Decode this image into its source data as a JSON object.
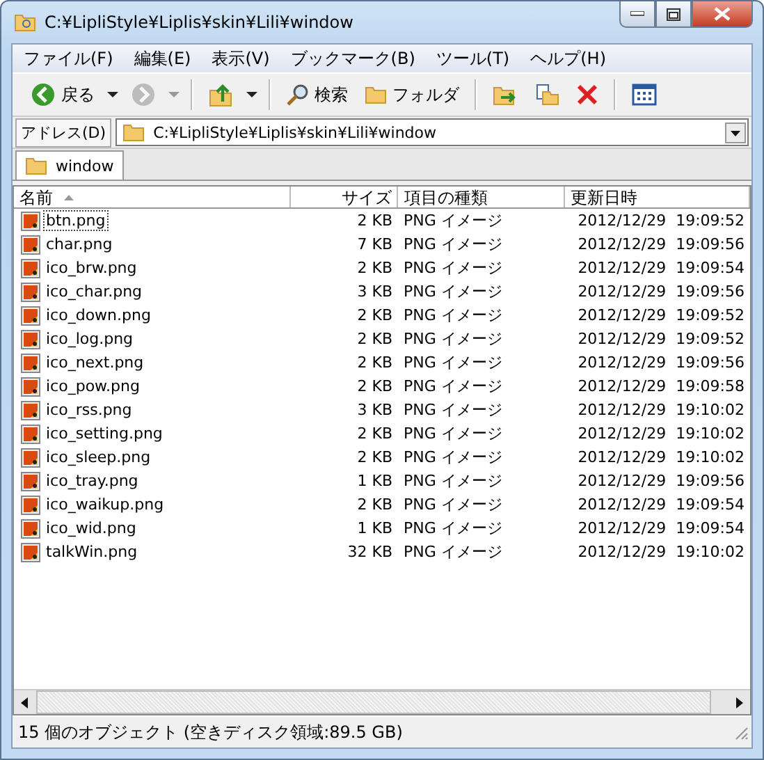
{
  "window": {
    "title": "C:¥LipliStyle¥Liplis¥skin¥Lili¥window"
  },
  "menu": [
    "ファイル(F)",
    "編集(E)",
    "表示(V)",
    "ブックマーク(B)",
    "ツール(T)",
    "ヘルプ(H)"
  ],
  "toolbar": [
    {
      "kind": "back",
      "label": "戻る",
      "disabled": false
    },
    {
      "kind": "caret",
      "disabled": false
    },
    {
      "kind": "forward",
      "disabled": true
    },
    {
      "kind": "caret",
      "disabled": true
    },
    {
      "kind": "sep"
    },
    {
      "kind": "up",
      "disabled": false
    },
    {
      "kind": "caret",
      "disabled": false
    },
    {
      "kind": "sep"
    },
    {
      "kind": "search",
      "label": "検索",
      "disabled": false
    },
    {
      "kind": "folders",
      "label": "フォルダ",
      "disabled": false
    },
    {
      "kind": "sep"
    },
    {
      "kind": "moveto",
      "disabled": false
    },
    {
      "kind": "copyto",
      "disabled": false
    },
    {
      "kind": "delete",
      "disabled": false
    },
    {
      "kind": "sep"
    },
    {
      "kind": "views",
      "disabled": false
    }
  ],
  "address": {
    "label": "アドレス(D)",
    "value": "C:¥LipliStyle¥Liplis¥skin¥Lili¥window"
  },
  "tabs": [
    {
      "label": "window",
      "selected": true
    }
  ],
  "table": {
    "columns": [
      "名前",
      "サイズ",
      "項目の種類",
      "更新日時"
    ],
    "rows": [
      {
        "name": "btn.png",
        "size": "2 KB",
        "type": "PNG イメージ",
        "modified": "2012/12/29  19:09:52",
        "focused": true
      },
      {
        "name": "char.png",
        "size": "7 KB",
        "type": "PNG イメージ",
        "modified": "2012/12/29  19:09:56",
        "focused": false
      },
      {
        "name": "ico_brw.png",
        "size": "2 KB",
        "type": "PNG イメージ",
        "modified": "2012/12/29  19:09:54",
        "focused": false
      },
      {
        "name": "ico_char.png",
        "size": "3 KB",
        "type": "PNG イメージ",
        "modified": "2012/12/29  19:09:56",
        "focused": false
      },
      {
        "name": "ico_down.png",
        "size": "2 KB",
        "type": "PNG イメージ",
        "modified": "2012/12/29  19:09:52",
        "focused": false
      },
      {
        "name": "ico_log.png",
        "size": "2 KB",
        "type": "PNG イメージ",
        "modified": "2012/12/29  19:09:52",
        "focused": false
      },
      {
        "name": "ico_next.png",
        "size": "2 KB",
        "type": "PNG イメージ",
        "modified": "2012/12/29  19:09:56",
        "focused": false
      },
      {
        "name": "ico_pow.png",
        "size": "2 KB",
        "type": "PNG イメージ",
        "modified": "2012/12/29  19:09:58",
        "focused": false
      },
      {
        "name": "ico_rss.png",
        "size": "3 KB",
        "type": "PNG イメージ",
        "modified": "2012/12/29  19:10:02",
        "focused": false
      },
      {
        "name": "ico_setting.png",
        "size": "2 KB",
        "type": "PNG イメージ",
        "modified": "2012/12/29  19:10:02",
        "focused": false
      },
      {
        "name": "ico_sleep.png",
        "size": "2 KB",
        "type": "PNG イメージ",
        "modified": "2012/12/29  19:10:02",
        "focused": false
      },
      {
        "name": "ico_tray.png",
        "size": "1 KB",
        "type": "PNG イメージ",
        "modified": "2012/12/29  19:09:56",
        "focused": false
      },
      {
        "name": "ico_waikup.png",
        "size": "2 KB",
        "type": "PNG イメージ",
        "modified": "2012/12/29  19:09:54",
        "focused": false
      },
      {
        "name": "ico_wid.png",
        "size": "1 KB",
        "type": "PNG イメージ",
        "modified": "2012/12/29  19:09:54",
        "focused": false
      },
      {
        "name": "talkWin.png",
        "size": "32 KB",
        "type": "PNG イメージ",
        "modified": "2012/12/29  19:10:02",
        "focused": false
      }
    ]
  },
  "status_bar": "15 個のオブジェクト (空きディスク領域:89.5 GB)"
}
